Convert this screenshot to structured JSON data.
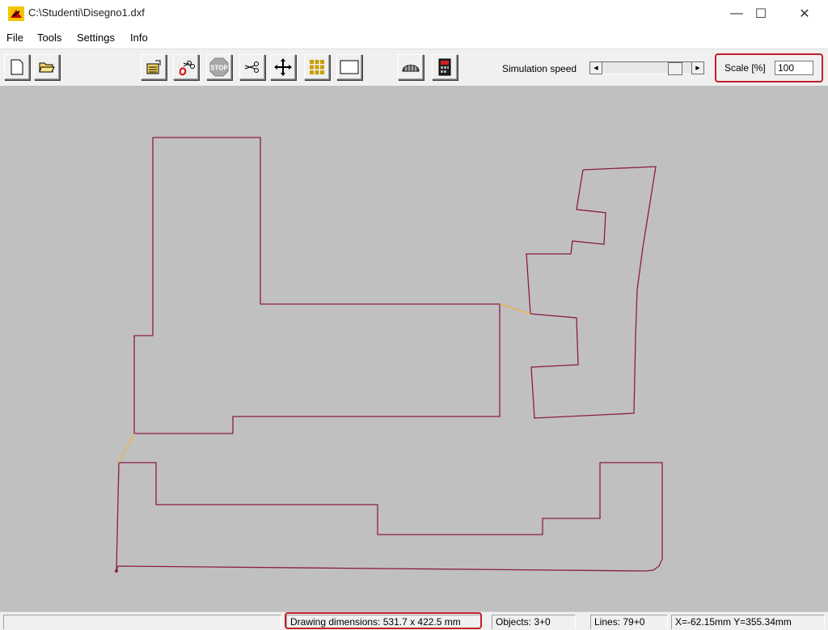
{
  "window": {
    "title": "C:\\Studenti\\Disegno1.dxf",
    "minimize_glyph": "—",
    "maximize_glyph": "☐",
    "close_glyph": "✕"
  },
  "menu": [
    "File",
    "Tools",
    "Settings",
    "Info"
  ],
  "toolbar": {
    "buttons": [
      "new-file-icon",
      "open-folder-icon",
      "export-icon",
      "cut-path-icon",
      "stop-icon",
      "scissors-icon",
      "move-icon",
      "grid-icon",
      "rectangle-icon",
      "machine-icon",
      "calculator-icon"
    ],
    "stop_text": "STOP",
    "speed_label": "Simulation speed",
    "speed_value": 0.88,
    "scale_label": "Scale [%]",
    "scale_value": "100"
  },
  "status": {
    "empty": "",
    "dimensions": "Drawing dimensions: 531.7 x 422.5 mm",
    "objects": "Objects: 3+0",
    "lines": "Lines: 79+0",
    "coords": "X=-62.15mm Y=355.34mm"
  },
  "colors": {
    "path": "#8b1a4a",
    "travel": "#f0b040",
    "canvas": "#c0c0c0",
    "highlight": "#c0202a"
  }
}
